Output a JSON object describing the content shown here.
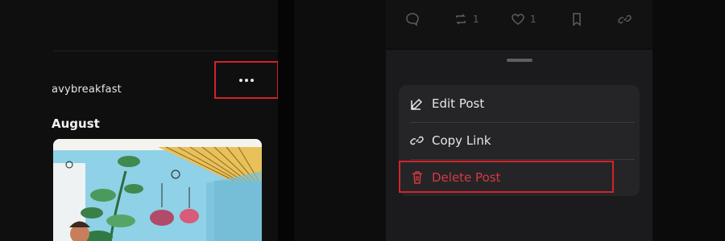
{
  "left_post": {
    "username": "avybreakfast",
    "title": "August"
  },
  "action_bar": {
    "repost_count": "1",
    "like_count": "1"
  },
  "menu": {
    "items": [
      {
        "label": "Edit Post",
        "icon": "edit-icon"
      },
      {
        "label": "Copy Link",
        "icon": "link-icon"
      },
      {
        "label": "Delete Post",
        "icon": "trash-icon"
      }
    ]
  },
  "colors": {
    "highlight": "#d2232a",
    "danger_text": "#d8383f",
    "menu_bg": "#252528",
    "sheet_bg": "#1b1b1d"
  }
}
